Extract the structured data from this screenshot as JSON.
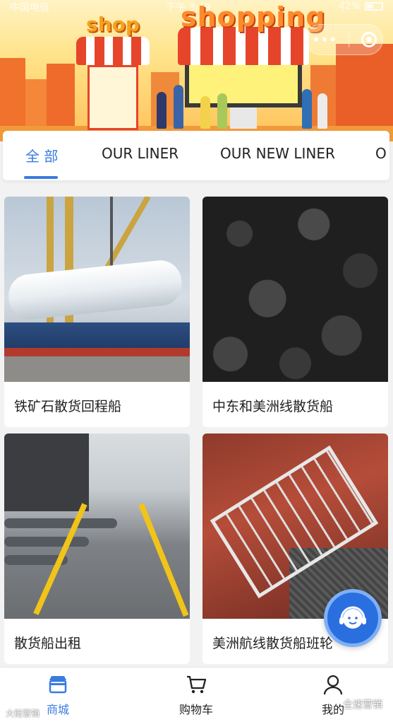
{
  "status_bar": {
    "carrier": "中国电信",
    "time": "下午 3:49",
    "battery": "42%"
  },
  "banner": {
    "shop_text": "shop",
    "shopping_text": "shopping",
    "capsule_more_icon": "more-dots-icon",
    "capsule_close_icon": "target-close-icon"
  },
  "tabs": [
    {
      "label": "全 部",
      "active": true
    },
    {
      "label": "OUR LINER",
      "active": false
    },
    {
      "label": "OUR NEW LINER",
      "active": false
    },
    {
      "label": "O",
      "active": false
    }
  ],
  "products": [
    {
      "title": "铁矿石散货回程船",
      "image": "ship-with-tank"
    },
    {
      "title": "中东和美洲线散货船",
      "image": "coal-pile"
    },
    {
      "title": "散货船出租",
      "image": "ship-deck"
    },
    {
      "title": "美洲航线散货船班轮",
      "image": "cargo-hold"
    }
  ],
  "service_button": {
    "icon": "customer-service-icon"
  },
  "tabbar": [
    {
      "label": "商城",
      "icon": "store-icon",
      "active": true
    },
    {
      "label": "购物车",
      "icon": "cart-icon",
      "active": false
    },
    {
      "label": "我的",
      "icon": "user-icon",
      "active": false
    }
  ],
  "watermarks": {
    "left": "大街营销",
    "right": "全速营销"
  },
  "colors": {
    "accent": "#3a7be0",
    "banner_orange": "#f7a21b",
    "awning_red": "#e6452b"
  }
}
